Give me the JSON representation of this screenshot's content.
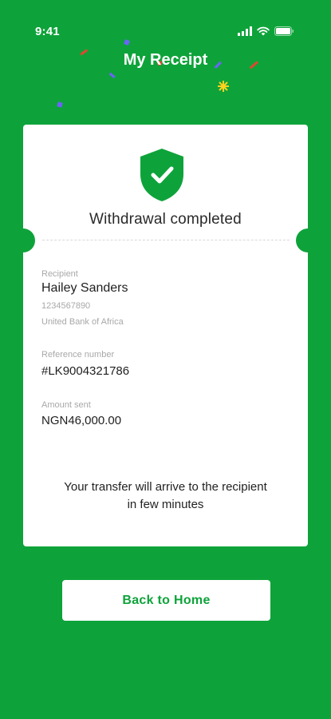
{
  "status_bar": {
    "time": "9:41"
  },
  "header": {
    "title": "My Receipt"
  },
  "receipt": {
    "title": "Withdrawal completed",
    "recipient_label": "Recipient",
    "recipient_name": "Hailey Sanders",
    "account_number": "1234567890",
    "bank_name": "United Bank of Africa",
    "reference_label": "Reference number",
    "reference_value": "#LK9004321786",
    "amount_label": "Amount sent",
    "amount_value": "NGN46,000.00",
    "message_line1": "Your transfer will arrive to the recipient",
    "message_line2": "in few minutes"
  },
  "actions": {
    "back_home_label": "Back to Home"
  },
  "colors": {
    "brand_green": "#0ea33a",
    "card_bg": "#ffffff",
    "text_dark": "#1f1f1f",
    "text_muted": "#a8a8a8"
  },
  "icons": [
    "cellular-signal-icon",
    "wifi-icon",
    "battery-icon",
    "shield-check-icon",
    "confetti-decoration"
  ]
}
